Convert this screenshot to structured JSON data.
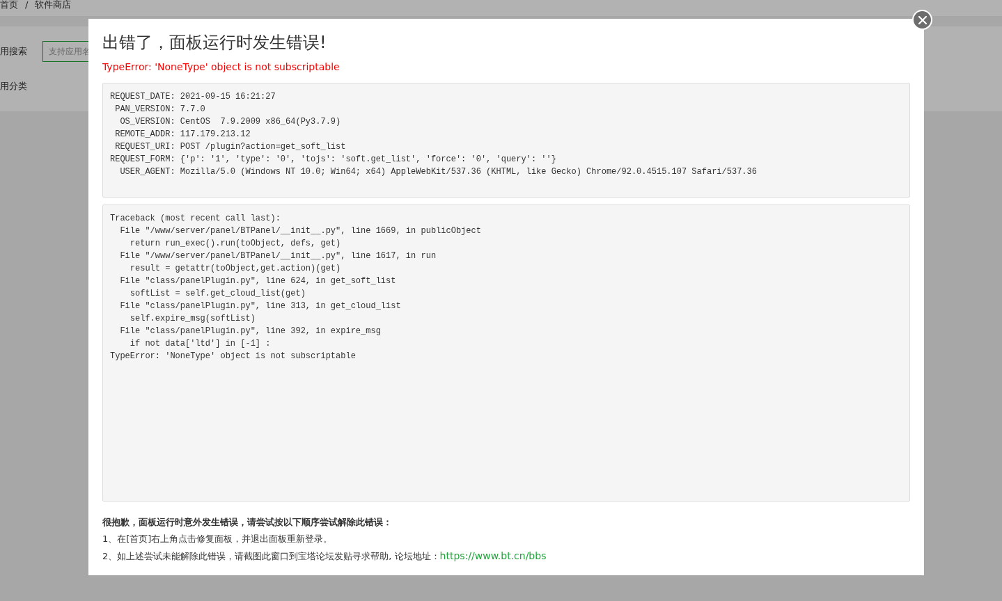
{
  "background_page": {
    "breadcrumb": [
      "首页",
      "/",
      "软件商店"
    ],
    "search_label": "用搜索",
    "search_field": {
      "placeholder": "支持应用名"
    },
    "category_label": "用分类"
  },
  "dialog": {
    "title": "出错了，面板运行时发生错误!",
    "error": "TypeError: 'NoneType' object is not subscriptable",
    "request_info": [
      "REQUEST_DATE: 2021-09-15 16:21:27",
      " PAN_VERSION: 7.7.0",
      "  OS_VERSION: CentOS  7.9.2009 x86_64(Py3.7.9)",
      " REMOTE_ADDR: 117.179.213.12",
      " REQUEST_URI: POST /plugin?action=get_soft_list",
      "REQUEST_FORM: {'p': '1', 'type': '0', 'tojs': 'soft.get_list', 'force': '0', 'query': ''}",
      "  USER_AGENT: Mozilla/5.0 (Windows NT 10.0; Win64; x64) AppleWebKit/537.36 (KHTML, like Gecko) Chrome/92.0.4515.107 Safari/537.36"
    ],
    "traceback": [
      "Traceback (most recent call last):",
      "  File \"/www/server/panel/BTPanel/__init__.py\", line 1669, in publicObject",
      "    return run_exec().run(toObject, defs, get)",
      "  File \"/www/server/panel/BTPanel/__init__.py\", line 1617, in run",
      "    result = getattr(toObject,get.action)(get)",
      "  File \"class/panelPlugin.py\", line 624, in get_soft_list",
      "    softList = self.get_cloud_list(get)",
      "  File \"class/panelPlugin.py\", line 313, in get_cloud_list",
      "    self.expire_msg(softList)",
      "  File \"class/panelPlugin.py\", line 392, in expire_msg",
      "    if not data['ltd'] in [-1] :",
      "TypeError: 'NoneType' object is not subscriptable"
    ],
    "help": {
      "heading": "很抱歉，面板运行时意外发生错误，请尝试按以下顺序尝试解除此错误：",
      "steps": [
        {
          "text": "1、在[首页]右上角点击修复面板，并退出面板重新登录。"
        },
        {
          "text": "2、如上述尝试未能解除此错误，请截图此窗口到宝塔论坛发贴寻求帮助, 论坛地址：",
          "link": "https://www.bt.cn/bbs"
        }
      ]
    }
  }
}
